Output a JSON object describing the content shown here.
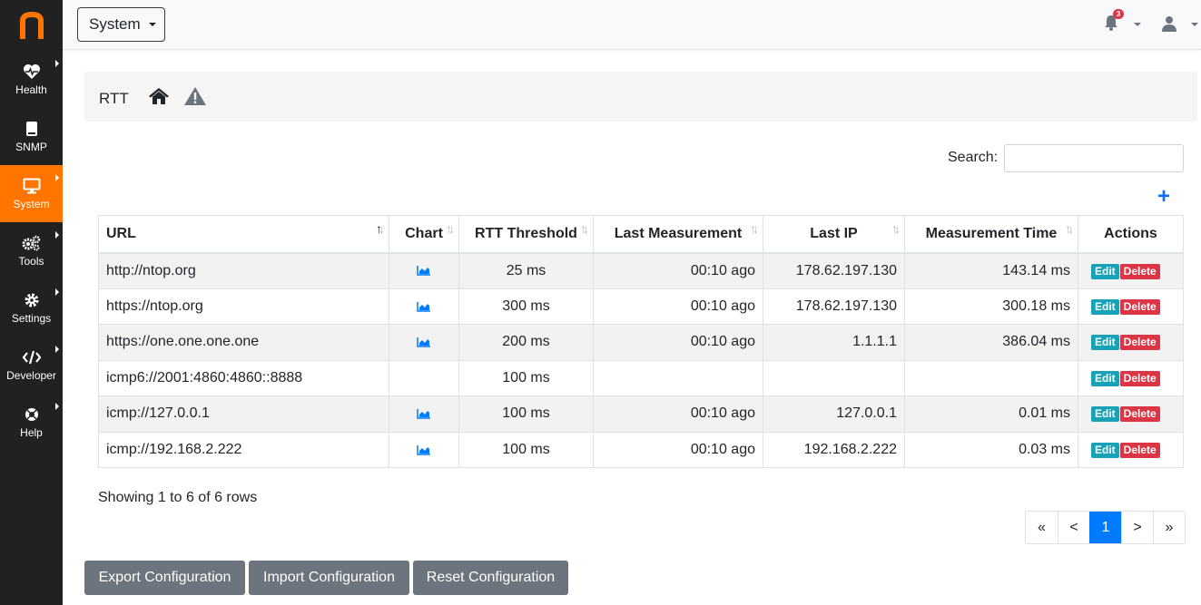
{
  "sidebar": {
    "items": [
      {
        "label": "Health",
        "icon": "heartbeat-icon"
      },
      {
        "label": "SNMP",
        "icon": "device-icon"
      },
      {
        "label": "System",
        "icon": "desktop-icon"
      },
      {
        "label": "Tools",
        "icon": "cogs-icon"
      },
      {
        "label": "Settings",
        "icon": "cog-icon"
      },
      {
        "label": "Developer",
        "icon": "code-icon"
      },
      {
        "label": "Help",
        "icon": "life-ring-icon"
      }
    ],
    "active": "System",
    "accent": "#ff7500",
    "background": "#212121"
  },
  "topbar": {
    "dropdown_label": "System",
    "notification_count": "3"
  },
  "page": {
    "title": "RTT"
  },
  "search": {
    "label": "Search:",
    "value": ""
  },
  "table": {
    "headers": [
      "URL",
      "Chart",
      "RTT Threshold",
      "Last Measurement",
      "Last IP",
      "Measurement Time",
      "Actions"
    ],
    "sorted_column": "URL",
    "rows": [
      {
        "url": "http://ntop.org",
        "chart": true,
        "threshold": "25 ms",
        "last": "00:10 ago",
        "ip": "178.62.197.130",
        "time": "143.14 ms"
      },
      {
        "url": "https://ntop.org",
        "chart": true,
        "threshold": "300 ms",
        "last": "00:10 ago",
        "ip": "178.62.197.130",
        "time": "300.18 ms"
      },
      {
        "url": "https://one.one.one.one",
        "chart": true,
        "threshold": "200 ms",
        "last": "00:10 ago",
        "ip": "1.1.1.1",
        "time": "386.04 ms"
      },
      {
        "url": "icmp6://2001:4860:4860::8888",
        "chart": false,
        "threshold": "100 ms",
        "last": "",
        "ip": "",
        "time": ""
      },
      {
        "url": "icmp://127.0.0.1",
        "chart": true,
        "threshold": "100 ms",
        "last": "00:10 ago",
        "ip": "127.0.0.1",
        "time": "0.01 ms"
      },
      {
        "url": "icmp://192.168.2.222",
        "chart": true,
        "threshold": "100 ms",
        "last": "00:10 ago",
        "ip": "192.168.2.222",
        "time": "0.03 ms"
      }
    ],
    "edit_label": "Edit",
    "delete_label": "Delete"
  },
  "footer": {
    "showing": "Showing 1 to 6 of 6 rows",
    "pages": [
      "«",
      "<",
      "1",
      ">",
      "»"
    ],
    "current_page": "1"
  },
  "config_buttons": {
    "export": "Export Configuration",
    "import": "Import Configuration",
    "reset": "Reset Configuration"
  }
}
